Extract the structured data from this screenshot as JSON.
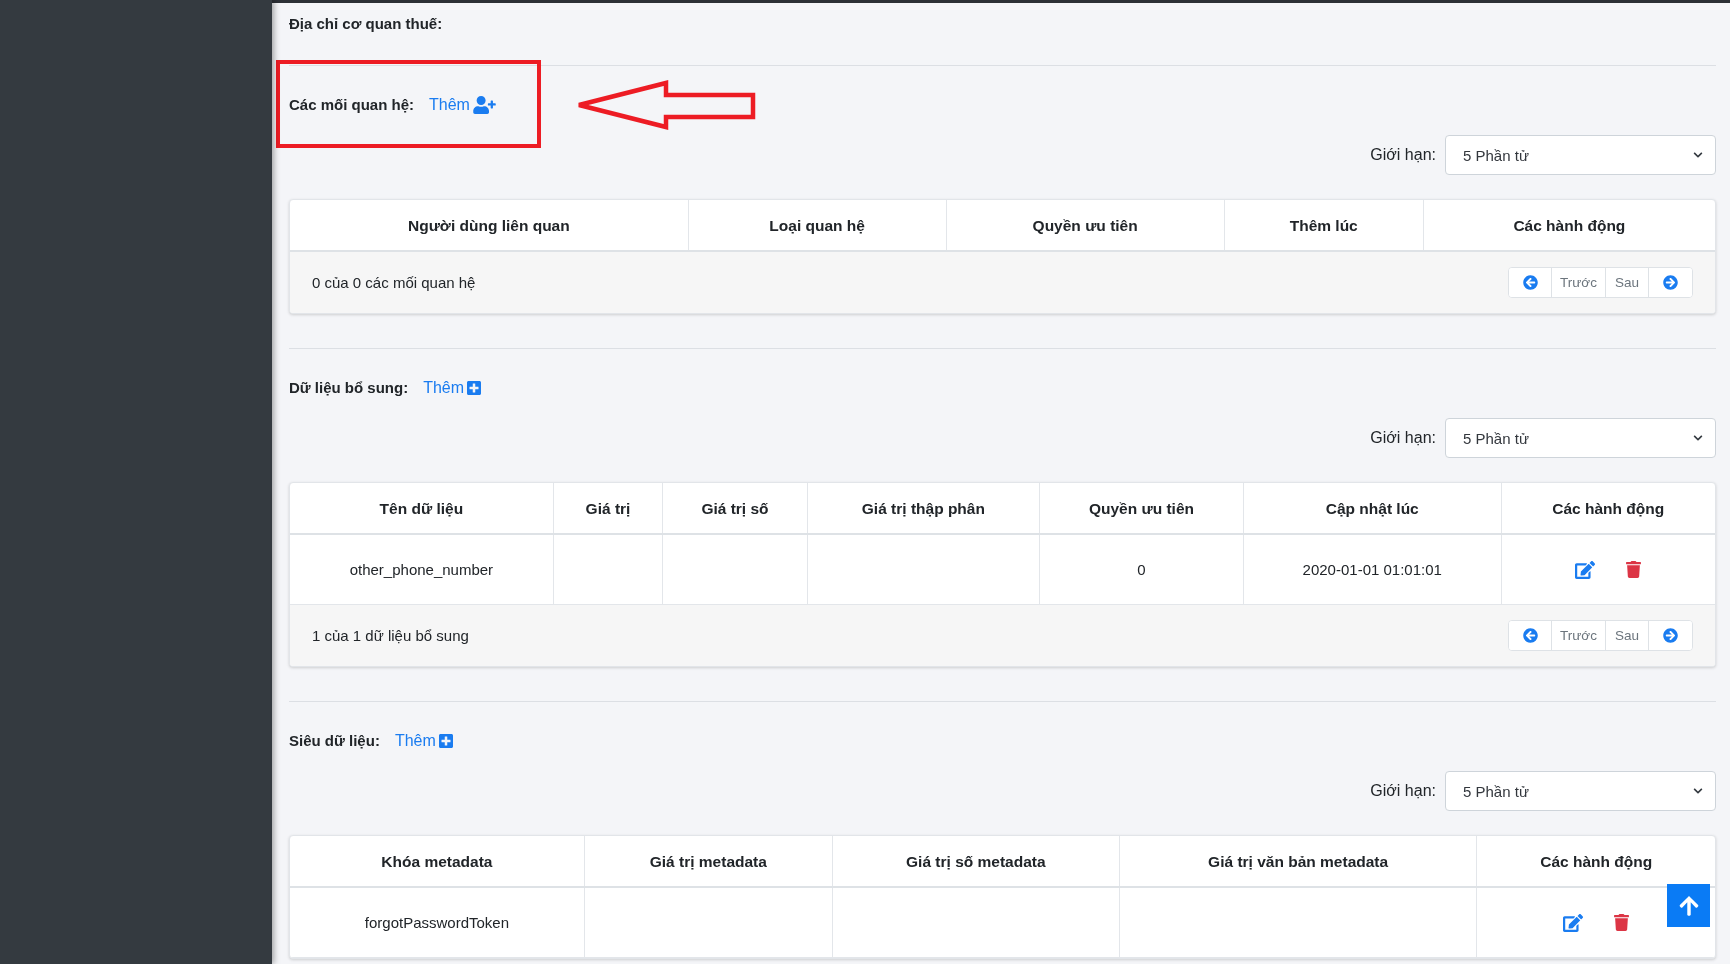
{
  "tax_office_address_label": "Địa chỉ cơ quan thuế:",
  "highlight_frame": true,
  "pointer_arrow": true,
  "sections": [
    {
      "title": "Các mối quan hệ:",
      "add_link": {
        "label": "Thêm",
        "kind": "person"
      },
      "limit": {
        "label": "Giới hạn:",
        "value": "5 Phần tử"
      },
      "table": {
        "columns": [
          "Người dùng liên quan",
          "Loại quan hệ",
          "Quyền ưu tiên",
          "Thêm lúc",
          "Các hành động"
        ],
        "summary": "0 của 0 các mối quan hệ",
        "pager": {
          "previous": "Trước",
          "next": "Sau"
        }
      }
    },
    {
      "title": "Dữ liệu bổ sung:",
      "add_link": {
        "label": "Thêm",
        "kind": "square"
      },
      "limit": {
        "label": "Giới hạn:",
        "value": "5 Phần tử"
      },
      "table": {
        "columns": [
          "Tên dữ liệu",
          "Giá trị",
          "Giá trị số",
          "Giá trị thập phân",
          "Quyền ưu tiên",
          "Cập nhật lúc",
          "Các hành động"
        ],
        "rows": [
          {
            "cells": [
              "other_phone_number",
              null,
              null,
              null,
              "0",
              "2020-01-01 01:01:01"
            ],
            "actions": true
          }
        ],
        "summary": "1 của 1 dữ liệu bổ sung",
        "pager": {
          "previous": "Trước",
          "next": "Sau"
        }
      }
    },
    {
      "title": "Siêu dữ liệu:",
      "add_link": {
        "label": "Thêm",
        "kind": "square"
      },
      "limit": {
        "label": "Giới hạn:",
        "value": "5 Phần tử"
      },
      "table": {
        "columns": [
          "Khóa metadata",
          "Giá trị metadata",
          "Giá trị số metadata",
          "Giá trị văn bản metadata",
          "Các hành động"
        ],
        "rows": [
          {
            "cells": [
              "forgotPasswordToken",
              null,
              null,
              null
            ],
            "actions": true
          }
        ]
      }
    }
  ],
  "back_to_top_button": true
}
